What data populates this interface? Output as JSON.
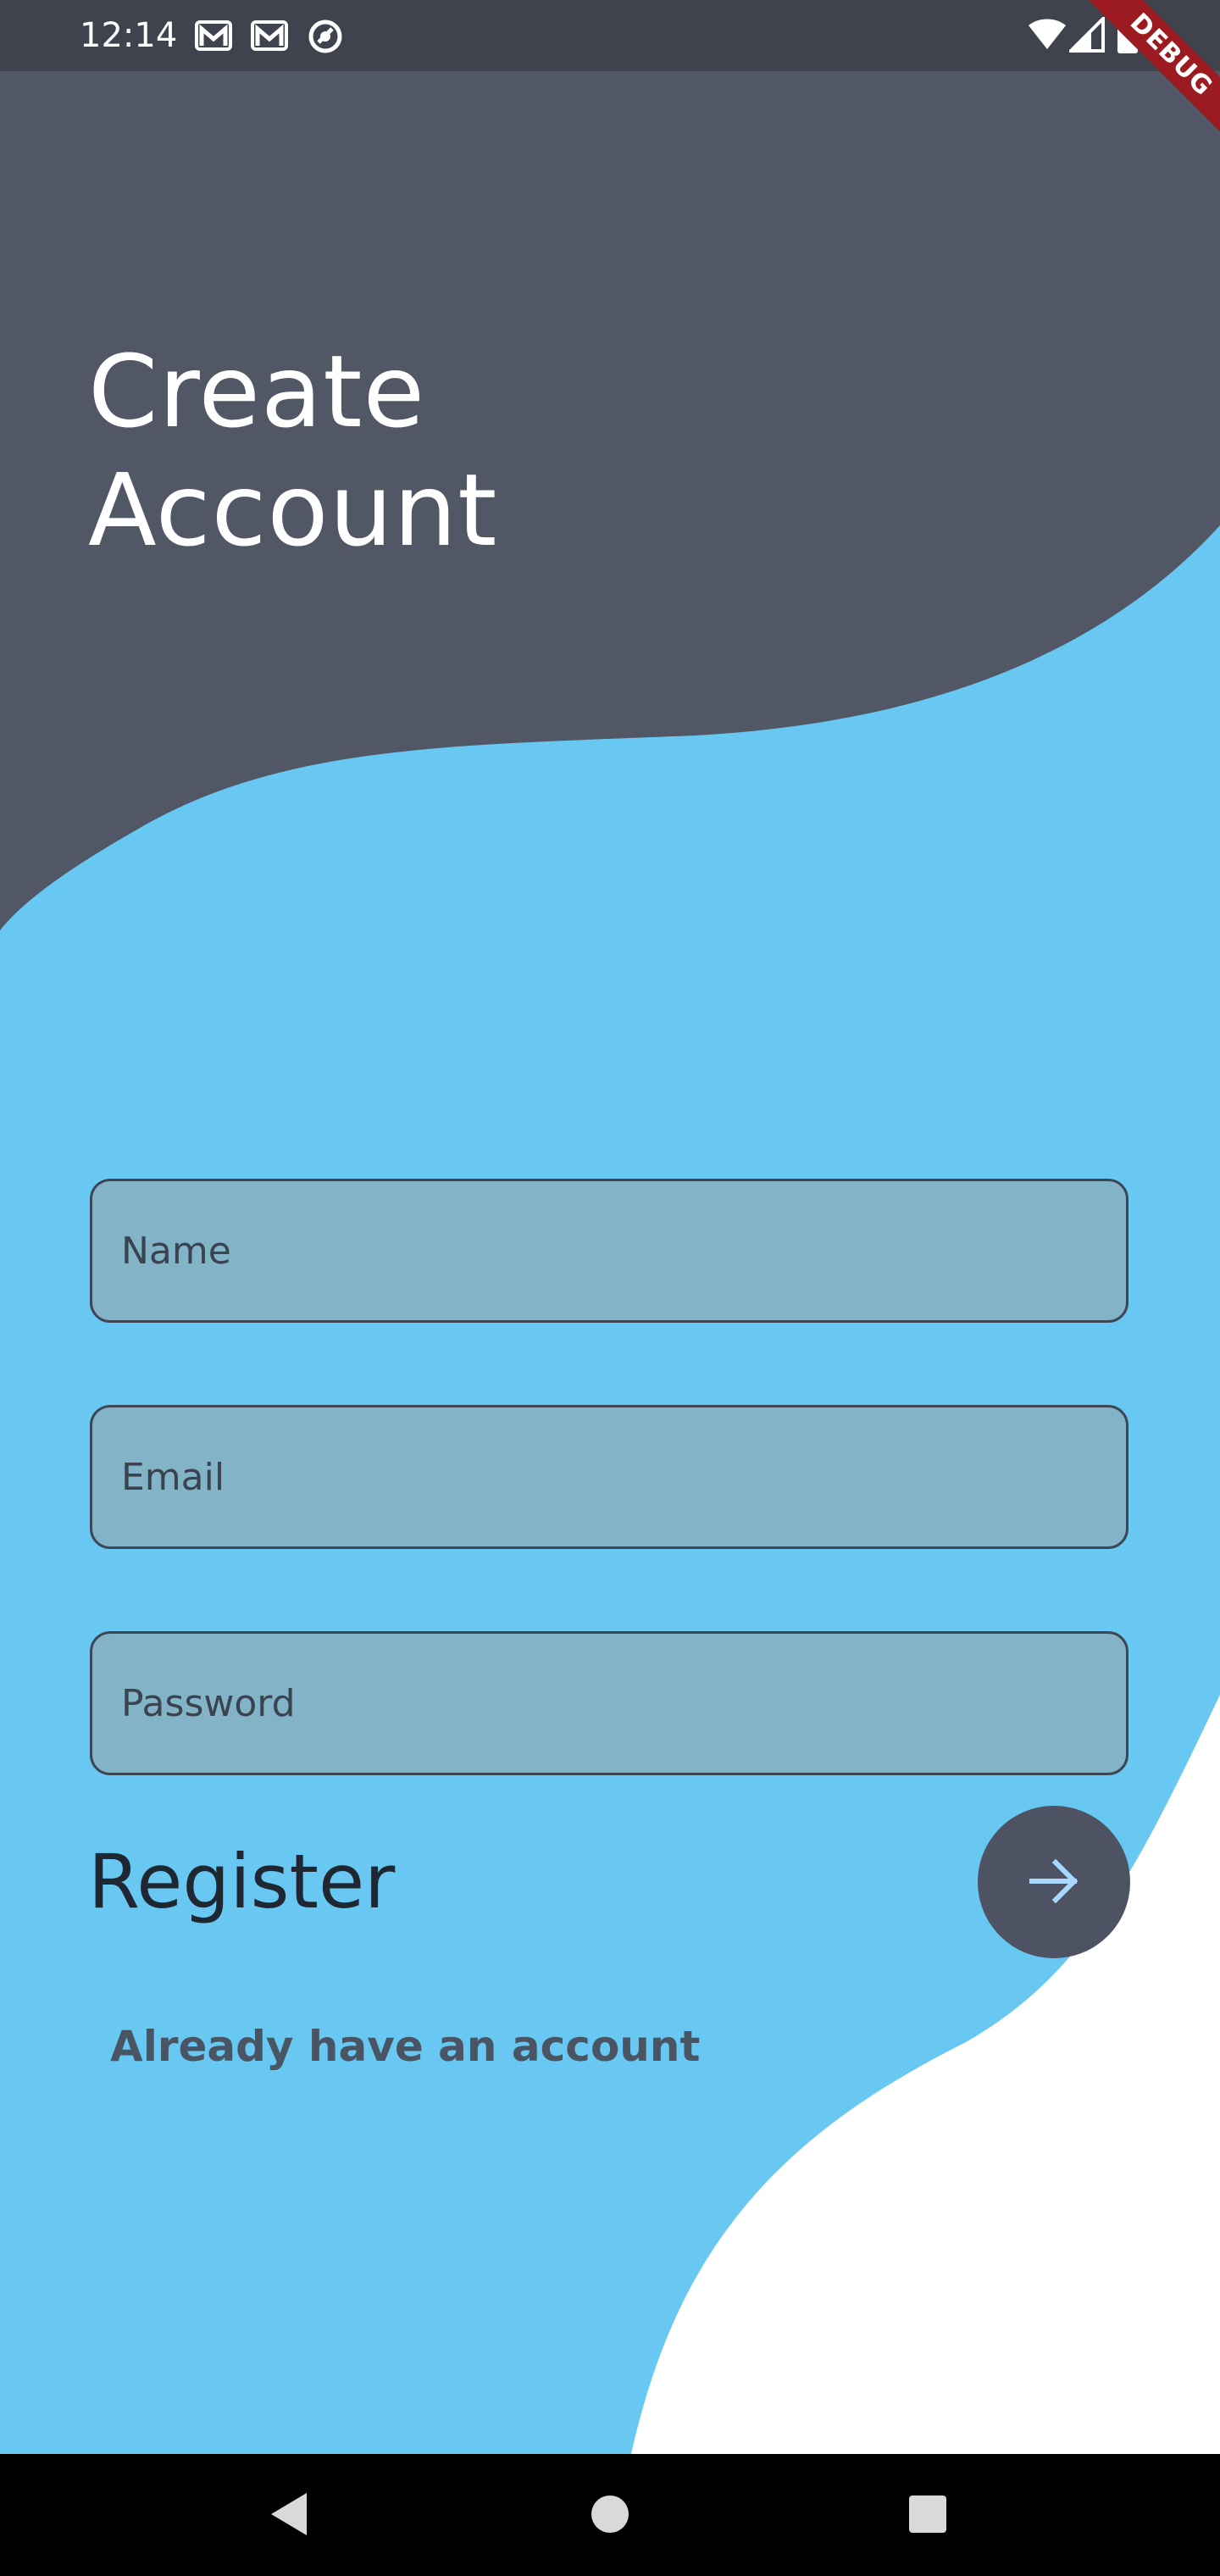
{
  "status_bar": {
    "time": "12:14",
    "notifications": [
      "gmail-icon",
      "gmail-icon",
      "sync-icon"
    ],
    "system": [
      "wifi-icon",
      "signal-icon",
      "battery-icon"
    ],
    "debug_label": "DEBUG"
  },
  "header": {
    "title_line1": "Create",
    "title_line2": "Account"
  },
  "form": {
    "name_placeholder": "Name",
    "email_placeholder": "Email",
    "password_placeholder": "Password",
    "register_label": "Register",
    "register_button_icon": "arrow-right-icon",
    "login_link": "Already have an account"
  },
  "nav_bar": {
    "buttons": [
      "back-icon",
      "home-icon",
      "recents-icon"
    ]
  },
  "colors": {
    "dark": "#525766",
    "status_bar": "#3f434e",
    "blue": "#68c8f1",
    "field_fill": "#83b3c6",
    "white": "#ffffff",
    "arrow": "#a9d8ff"
  }
}
